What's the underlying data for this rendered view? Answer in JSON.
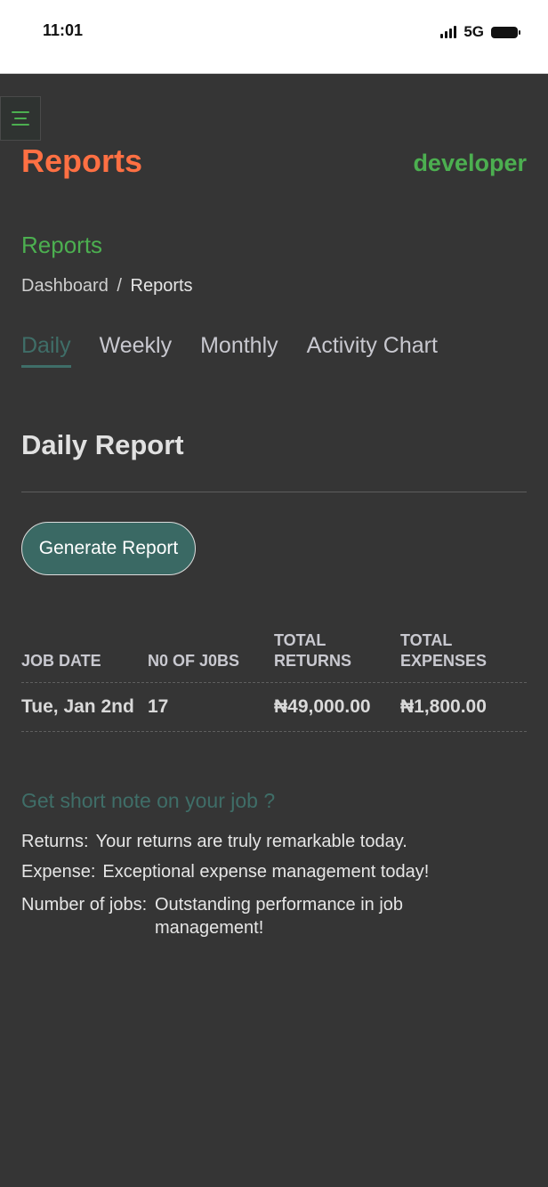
{
  "status_bar": {
    "time": "11:01",
    "network": "5G"
  },
  "header": {
    "title": "Reports",
    "user": "developer"
  },
  "section": {
    "title": "Reports"
  },
  "breadcrumb": {
    "parent": "Dashboard",
    "separator": "/",
    "current": "Reports"
  },
  "tabs": [
    {
      "label": "Daily",
      "active": true
    },
    {
      "label": "Weekly",
      "active": false
    },
    {
      "label": "Monthly",
      "active": false
    },
    {
      "label": "Activity Chart",
      "active": false
    }
  ],
  "report": {
    "heading": "Daily Report",
    "generate_button": "Generate Report"
  },
  "table": {
    "headers": [
      "JOB DATE",
      "N0 OF J0BS",
      "TOTAL RETURNS",
      "TOTAL EXPENSES"
    ],
    "rows": [
      {
        "job_date": "Tue, Jan 2nd",
        "no_of_jobs": "17",
        "total_returns": "₦49,000.00",
        "total_expenses": "₦1,800.00"
      }
    ]
  },
  "notes": {
    "title": "Get short note on your job ?",
    "items": [
      {
        "label": "Returns:",
        "text": "Your returns are truly remarkable today."
      },
      {
        "label": "Expense:",
        "text": "Exceptional expense management today!"
      },
      {
        "label": "Number of jobs:",
        "text": "Outstanding performance in job management!"
      }
    ]
  },
  "colors": {
    "background": "#353535",
    "title_orange": "#ff7043",
    "green": "#4caf50",
    "teal": "#3f6e68"
  },
  "icons": {
    "menu": "hamburger-menu-icon",
    "signal": "signal-bars-icon",
    "battery": "battery-icon"
  }
}
